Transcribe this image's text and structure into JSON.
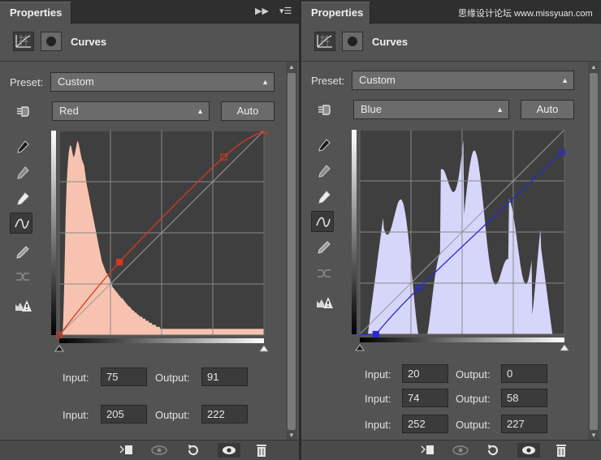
{
  "watermark": "思缘设计论坛 www.missyuan.com",
  "panels": [
    {
      "tab": "Properties",
      "adjustment_title": "Curves",
      "preset_label": "Preset:",
      "preset_value": "Custom",
      "channel_value": "Red",
      "auto_label": "Auto",
      "curve_color": "#d23a22",
      "histogram_fill": "#f7c3b0",
      "curve_points": [
        [
          0,
          0
        ],
        [
          75,
          91
        ],
        [
          205,
          222
        ],
        [
          255,
          255
        ]
      ],
      "selected_point_index": 1,
      "rows": [
        {
          "input_label": "Input:",
          "input_value": "75",
          "output_label": "Output:",
          "output_value": "91"
        },
        {
          "input_label": "Input:",
          "input_value": "205",
          "output_label": "Output:",
          "output_value": "222"
        }
      ]
    },
    {
      "tab": "Properties",
      "adjustment_title": "Curves",
      "preset_label": "Preset:",
      "preset_value": "Custom",
      "channel_value": "Blue",
      "auto_label": "Auto",
      "curve_color": "#2a2ad0",
      "histogram_fill": "#d6d6fb",
      "curve_points": [
        [
          20,
          0
        ],
        [
          74,
          58
        ],
        [
          252,
          227
        ]
      ],
      "selected_point_index": 0,
      "rows": [
        {
          "input_label": "Input:",
          "input_value": "20",
          "output_label": "Output:",
          "output_value": "0"
        },
        {
          "input_label": "Input:",
          "input_value": "74",
          "output_label": "Output:",
          "output_value": "58"
        },
        {
          "input_label": "Input:",
          "input_value": "252",
          "output_label": "Output:",
          "output_value": "227"
        }
      ]
    }
  ],
  "histogram_left": [
    0,
    0,
    0,
    0,
    0,
    8,
    22,
    40,
    60,
    72,
    80,
    86,
    90,
    92,
    93,
    92,
    90,
    88,
    87,
    88,
    90,
    92,
    94,
    95,
    94,
    92,
    90,
    88,
    86,
    85,
    84,
    83,
    80,
    77,
    74,
    72,
    70,
    68,
    66,
    64,
    62,
    60,
    58,
    56,
    54,
    52,
    50,
    48,
    46,
    44,
    42,
    40,
    38,
    36,
    35,
    34,
    33,
    32,
    31,
    30,
    30,
    29,
    28,
    27,
    26,
    25,
    24,
    23,
    23,
    22,
    22,
    21,
    21,
    20,
    20,
    19,
    19,
    18,
    18,
    18,
    17,
    17,
    16,
    16,
    15,
    15,
    14,
    14,
    14,
    13,
    13,
    12,
    12,
    12,
    11,
    11,
    11,
    10,
    10,
    10,
    9,
    9,
    9,
    9,
    8,
    8,
    8,
    8,
    7,
    7,
    7,
    7,
    6,
    6,
    6,
    6,
    5,
    5,
    5,
    5,
    5,
    4,
    4,
    4,
    4,
    4,
    3,
    3,
    3,
    3,
    3,
    3,
    3,
    3,
    3,
    3,
    3,
    3,
    3,
    3,
    3,
    3,
    3,
    3,
    3,
    3,
    3,
    3,
    3,
    3,
    3,
    3,
    3,
    3,
    3,
    3,
    3,
    3,
    3,
    3,
    3,
    3,
    3,
    3,
    3,
    3,
    3,
    3,
    3,
    3,
    3,
    3,
    3,
    3,
    3,
    3,
    3,
    3,
    3,
    3,
    3,
    3,
    3,
    3,
    3,
    3,
    3,
    3,
    3,
    3,
    3,
    3,
    3,
    3,
    3,
    3,
    3,
    3,
    3,
    3,
    3,
    3,
    3,
    3,
    3,
    3,
    3,
    3,
    3,
    3,
    3,
    3,
    3,
    3,
    3,
    3,
    3,
    3,
    3,
    3,
    3,
    3,
    3,
    3,
    3,
    3,
    3,
    3,
    3,
    3,
    3,
    3,
    3,
    3,
    3,
    3,
    3,
    3,
    3,
    3,
    3,
    3,
    3,
    3,
    3,
    3,
    3,
    3,
    3,
    3,
    3,
    3,
    3,
    3,
    3,
    3,
    3,
    3,
    3,
    3,
    3,
    3,
    3,
    3,
    3,
    3,
    3
  ],
  "histogram_right": [
    0,
    0,
    0,
    0,
    0,
    0,
    0,
    0,
    0,
    0,
    0,
    0,
    0,
    0,
    0,
    0,
    0,
    0,
    0,
    0,
    0,
    0,
    0,
    0,
    0,
    0,
    0,
    0,
    0,
    0,
    0,
    0,
    0,
    0,
    0,
    0,
    0,
    0,
    0,
    0,
    0,
    0,
    0,
    0,
    0,
    0,
    0,
    0,
    0,
    0,
    0,
    0,
    0,
    0,
    0,
    0,
    0,
    0,
    0,
    0,
    0,
    0,
    0,
    0,
    0,
    0,
    0,
    0,
    0,
    0,
    0,
    0,
    0,
    0,
    0,
    0,
    0,
    0,
    0,
    0,
    0,
    0,
    0,
    0,
    0,
    0,
    0,
    0,
    0,
    0,
    0,
    0,
    0,
    0,
    0,
    0,
    0,
    0,
    0,
    0,
    0,
    0,
    0,
    0,
    0,
    0,
    0,
    0,
    0,
    0,
    0,
    0,
    0,
    0,
    0,
    0,
    0,
    0,
    0,
    0,
    0,
    0,
    0,
    0,
    0,
    0,
    0,
    0,
    0,
    0,
    0,
    0,
    0,
    0,
    0,
    0,
    0,
    0,
    0,
    0,
    0,
    0,
    0,
    0,
    0,
    0,
    0,
    0,
    0,
    0,
    0,
    0,
    0,
    0,
    0,
    0,
    0,
    0,
    0,
    0,
    0,
    0,
    0,
    0,
    0,
    0,
    0,
    0,
    0,
    0,
    0,
    0,
    0,
    0,
    0,
    0,
    0,
    0,
    0,
    0,
    0,
    0,
    0,
    0,
    0,
    0,
    0,
    0,
    0,
    0,
    0,
    0,
    0,
    0,
    0,
    0,
    0,
    0,
    0,
    0,
    0,
    0,
    0,
    0,
    0,
    0,
    0,
    0,
    0,
    0,
    0,
    0,
    0,
    0,
    0,
    0,
    0,
    0,
    0,
    0,
    0,
    0,
    0,
    0,
    0,
    0,
    0,
    0,
    0,
    0,
    0,
    0,
    0,
    0,
    0,
    0,
    0,
    0,
    0,
    0,
    0,
    0,
    0,
    0,
    0,
    0,
    0,
    0,
    0,
    0,
    0,
    0,
    0,
    0,
    0,
    0,
    0,
    0,
    0,
    0,
    0
  ]
}
